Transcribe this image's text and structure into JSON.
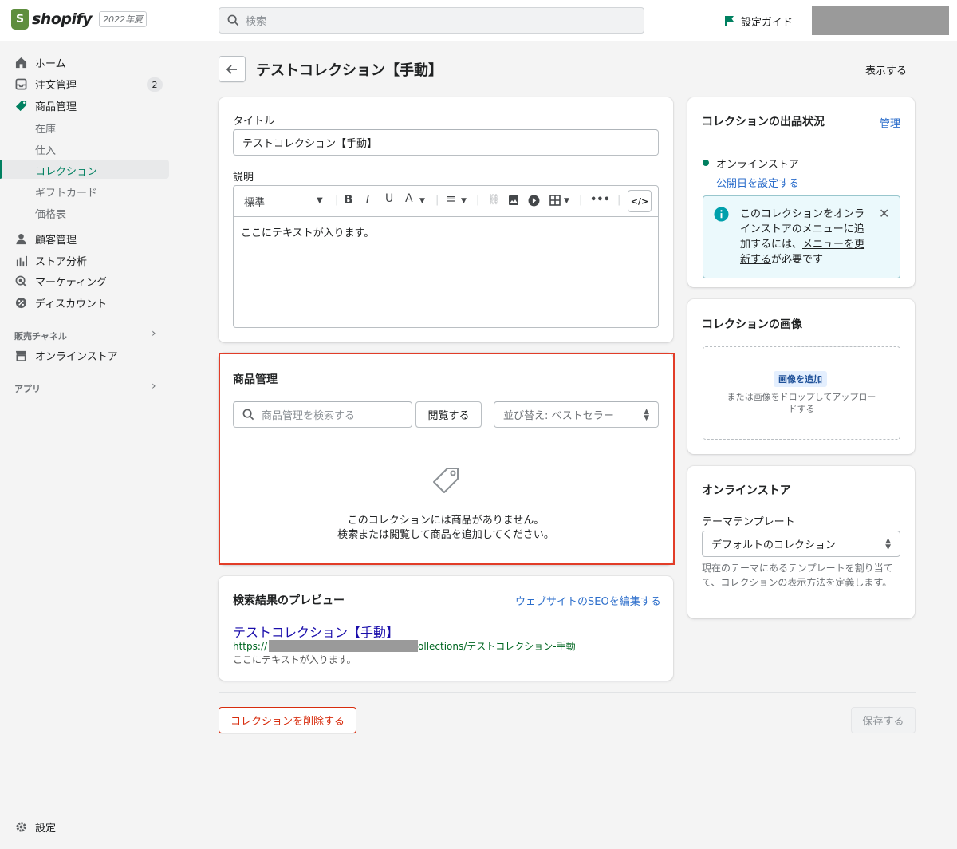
{
  "topbar": {
    "logo_text": "shopify",
    "edition": "2022年夏",
    "search_placeholder": "検索",
    "setup_guide": "設定ガイド"
  },
  "sidebar": {
    "home": "ホーム",
    "orders": "注文管理",
    "orders_badge": "2",
    "products": "商品管理",
    "sub_inventory": "在庫",
    "sub_purchase": "仕入",
    "sub_collections": "コレクション",
    "sub_giftcards": "ギフトカード",
    "sub_pricelists": "価格表",
    "customers": "顧客管理",
    "analytics": "ストア分析",
    "marketing": "マーケティング",
    "discounts": "ディスカウント",
    "sales_channels": "販売チャネル",
    "online_store": "オンラインストア",
    "apps": "アプリ",
    "settings": "設定"
  },
  "page": {
    "title": "テストコレクション【手動】",
    "view_action": "表示する"
  },
  "details_card": {
    "title_label": "タイトル",
    "title_value": "テストコレクション【手動】",
    "description_label": "説明",
    "format_select": "標準",
    "description_text": "ここにテキストが入ります。"
  },
  "products_card": {
    "title": "商品管理",
    "search_placeholder": "商品管理を検索する",
    "browse_button": "閲覧する",
    "sort_label": "並び替え: ベストセラー",
    "empty_line1": "このコレクションには商品がありません。",
    "empty_line2": "検索または閲覧して商品を追加してください。"
  },
  "seo_card": {
    "title": "検索結果のプレビュー",
    "edit_link": "ウェブサイトのSEOを編集する",
    "preview_title": "テストコレクション【手動】",
    "preview_url_prefix": "https://",
    "preview_url_suffix": "ollections/テストコレクション-手動",
    "preview_description": "ここにテキストが入ります。"
  },
  "availability_card": {
    "title": "コレクションの出品状況",
    "manage_link": "管理",
    "channel": "オンラインストア",
    "schedule_link": "公開日を設定する",
    "info_text_before": "このコレクションをオンラインストアのメニューに追加するには、",
    "info_link": "メニューを更新する",
    "info_text_after": "が必要です"
  },
  "image_card": {
    "title": "コレクションの画像",
    "add_button": "画像を追加",
    "drop_hint": "または画像をドロップしてアップロードする"
  },
  "online_store_card": {
    "title": "オンラインストア",
    "template_label": "テーマテンプレート",
    "template_value": "デフォルトのコレクション",
    "help_text": "現在のテーマにあるテンプレートを割り当てて、コレクションの表示方法を定義します。"
  },
  "footer": {
    "delete_button": "コレクションを削除する",
    "save_button": "保存する"
  },
  "colors": {
    "accent": "#008060",
    "link": "#2c6ecb",
    "critical": "#d72c0d",
    "highlight_frame": "#e23d28"
  }
}
